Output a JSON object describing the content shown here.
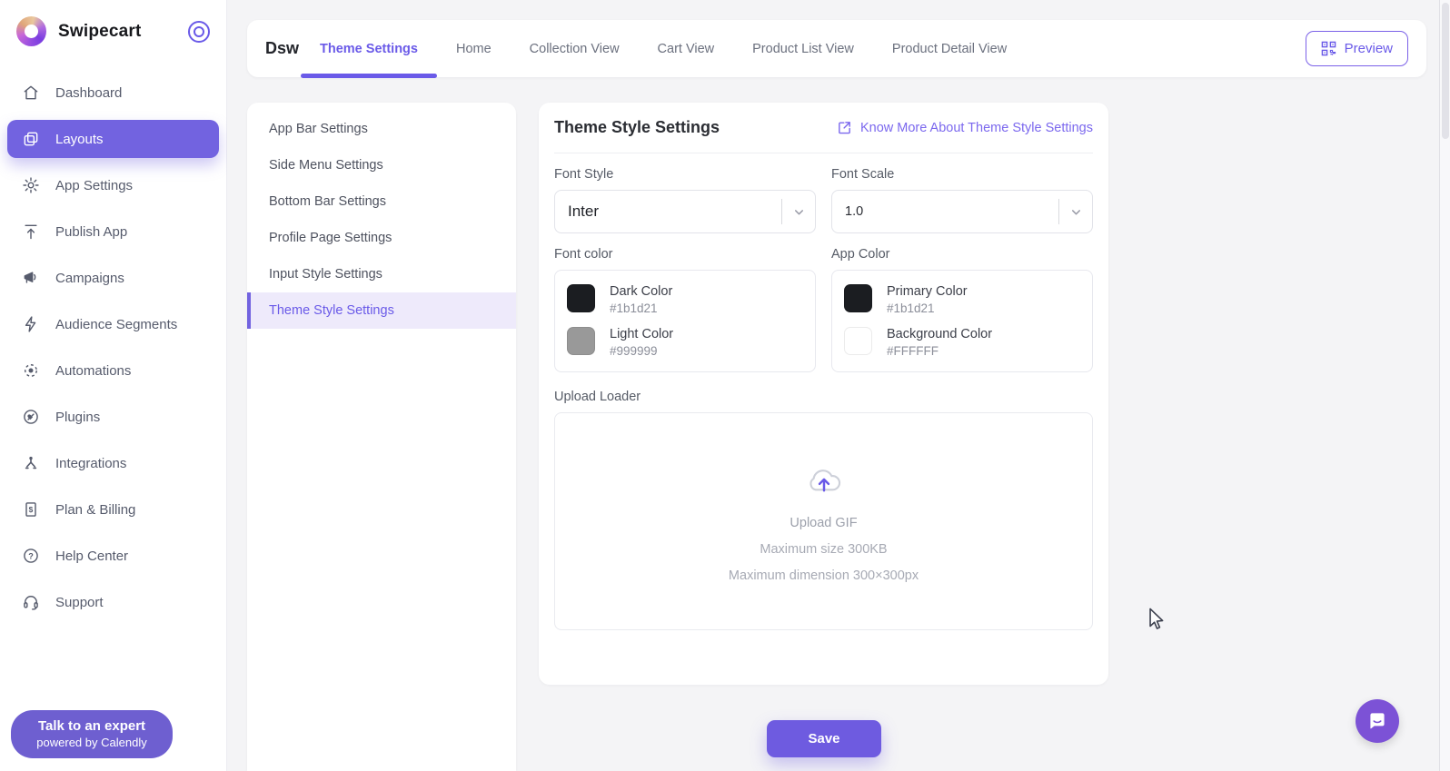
{
  "brand": {
    "name": "Swipecart"
  },
  "sidebar": {
    "items": [
      {
        "label": "Dashboard",
        "icon": "home-icon",
        "active": false
      },
      {
        "label": "Layouts",
        "icon": "layouts-icon",
        "active": true
      },
      {
        "label": "App Settings",
        "icon": "gear-icon",
        "active": false
      },
      {
        "label": "Publish App",
        "icon": "publish-icon",
        "active": false
      },
      {
        "label": "Campaigns",
        "icon": "megaphone-icon",
        "active": false
      },
      {
        "label": "Audience Segments",
        "icon": "lightning-icon",
        "active": false
      },
      {
        "label": "Automations",
        "icon": "automation-icon",
        "active": false
      },
      {
        "label": "Plugins",
        "icon": "plugin-icon",
        "active": false
      },
      {
        "label": "Integrations",
        "icon": "integration-icon",
        "active": false
      },
      {
        "label": "Plan & Billing",
        "icon": "billing-icon",
        "active": false
      },
      {
        "label": "Help Center",
        "icon": "help-icon",
        "active": false
      },
      {
        "label": "Support",
        "icon": "headset-icon",
        "active": false
      }
    ],
    "expert_button": {
      "line1": "Talk to an expert",
      "line2": "powered by Calendly"
    }
  },
  "topbar": {
    "app_name": "Dsw",
    "tabs": [
      {
        "label": "Theme Settings",
        "active": true
      },
      {
        "label": "Home",
        "active": false
      },
      {
        "label": "Collection View",
        "active": false
      },
      {
        "label": "Cart View",
        "active": false
      },
      {
        "label": "Product List View",
        "active": false
      },
      {
        "label": "Product Detail View",
        "active": false
      }
    ],
    "preview_button": "Preview"
  },
  "settings_menu": {
    "items": [
      {
        "label": "App Bar Settings",
        "active": false
      },
      {
        "label": "Side Menu Settings",
        "active": false
      },
      {
        "label": "Bottom Bar Settings",
        "active": false
      },
      {
        "label": "Profile Page Settings",
        "active": false
      },
      {
        "label": "Input Style Settings",
        "active": false
      },
      {
        "label": "Theme Style Settings",
        "active": true
      }
    ]
  },
  "panel": {
    "title": "Theme Style Settings",
    "know_more_link": "Know More About Theme Style Settings",
    "font_style": {
      "label": "Font Style",
      "value": "Inter"
    },
    "font_scale": {
      "label": "Font Scale",
      "value": "1.0"
    },
    "font_color": {
      "label": "Font color",
      "swatches": [
        {
          "name": "Dark Color",
          "hex": "#1b1d21"
        },
        {
          "name": "Light Color",
          "hex": "#999999"
        }
      ]
    },
    "app_color": {
      "label": "App Color",
      "swatches": [
        {
          "name": "Primary Color",
          "hex": "#1b1d21"
        },
        {
          "name": "Background Color",
          "hex": "#FFFFFF"
        }
      ]
    },
    "upload": {
      "label": "Upload Loader",
      "line1": "Upload GIF",
      "line2": "Maximum size 300KB",
      "line3": "Maximum dimension 300×300px"
    },
    "save_button": "Save"
  },
  "colors": {
    "accent": "#6a5ae8",
    "active_nav_bg": "#7263e0",
    "dark_swatch": "#1b1d21",
    "light_swatch": "#999999",
    "white_swatch": "#FFFFFF",
    "chat_widget": "#7c52d6"
  }
}
